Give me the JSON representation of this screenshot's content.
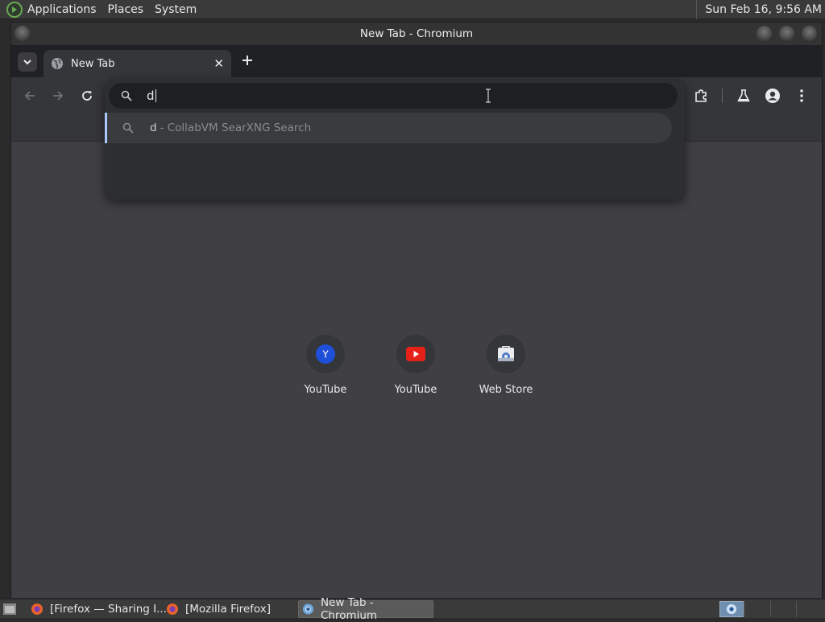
{
  "top_panel": {
    "menus": [
      "Applications",
      "Places",
      "System"
    ],
    "clock": "Sun Feb 16,  9:56 AM"
  },
  "window": {
    "title": "New Tab - Chromium"
  },
  "tabs": [
    {
      "label": "New Tab",
      "icon": "globe-icon"
    }
  ],
  "omnibox": {
    "value": "d",
    "suggestion": {
      "query": "d",
      "description": "- CollabVM SearXNG Search"
    }
  },
  "shortcuts": [
    {
      "label": "YouTube",
      "icon": "yandex-y-icon",
      "color": "#1e4fd8"
    },
    {
      "label": "YouTube",
      "icon": "youtube-icon",
      "color": "#e62117"
    },
    {
      "label": "Web Store",
      "icon": "web-store-icon",
      "color": "#4a78c8"
    }
  ],
  "taskbar": {
    "tasks": [
      {
        "label": "[Firefox — Sharing I...",
        "icon": "firefox-icon",
        "active": false
      },
      {
        "label": "[Mozilla Firefox]",
        "icon": "firefox-icon",
        "active": false
      },
      {
        "label": "New Tab - Chromium",
        "icon": "chromium-icon",
        "active": true
      }
    ]
  },
  "colors": {
    "accent": "#a8c7fa",
    "content_bg": "#3f3f44",
    "toolbar_bg": "#35363a",
    "tabstrip_bg": "#202124"
  }
}
